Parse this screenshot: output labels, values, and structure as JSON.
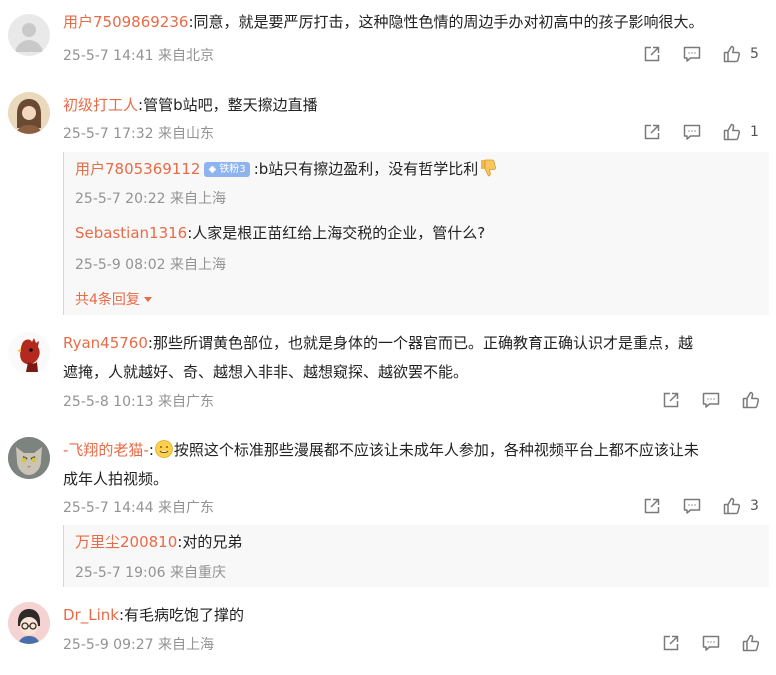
{
  "comments": [
    {
      "user": "用户7509869236",
      "content": ":同意，就是要严厉打击，这种隐性色情的周边手办对初高中的孩子影响很大。",
      "meta": "25-5-7 14:41 来自北京",
      "likes": "5"
    },
    {
      "user": "初级打工人",
      "content": ":管管b站吧，整天擦边直播",
      "meta": "25-5-7 17:32 来自山东",
      "likes": "1",
      "replies": [
        {
          "user": "用户7805369112",
          "badge": "铁粉3",
          "content": ":b站只有擦边盈利，没有哲学比利",
          "meta": "25-5-7 20:22 来自上海"
        },
        {
          "user": "Sebastian1316",
          "content": ":人家是根正苗红给上海交税的企业，管什么?",
          "meta": "25-5-9 08:02 来自上海"
        }
      ],
      "more_replies": "共4条回复"
    },
    {
      "user": "Ryan45760",
      "content_line1": ":那些所谓黄色部位，也就是身体的一个器官而已。正确教育正确认识才是重点，越",
      "content_line2": "遮掩，人就越好、奇、越想入非非、越想窥探、越欲罢不能。",
      "meta": "25-5-8 10:13 来自广东"
    },
    {
      "user": "-飞翔的老猫-",
      "content_line1": "按照这个标准那些漫展都不应该让未成年人参加，各种视频平台上都不应该让未",
      "content_line2": "成年人拍视频。",
      "meta": "25-5-7 14:44 来自广东",
      "likes": "3",
      "replies": [
        {
          "user": "万里尘200810",
          "content": ":对的兄弟",
          "meta": "25-5-7 19:06 来自重庆"
        }
      ]
    },
    {
      "user": "Dr_Link",
      "content": ":有毛病吃饱了撑的",
      "meta": "25-5-9 09:27 来自上海"
    }
  ]
}
